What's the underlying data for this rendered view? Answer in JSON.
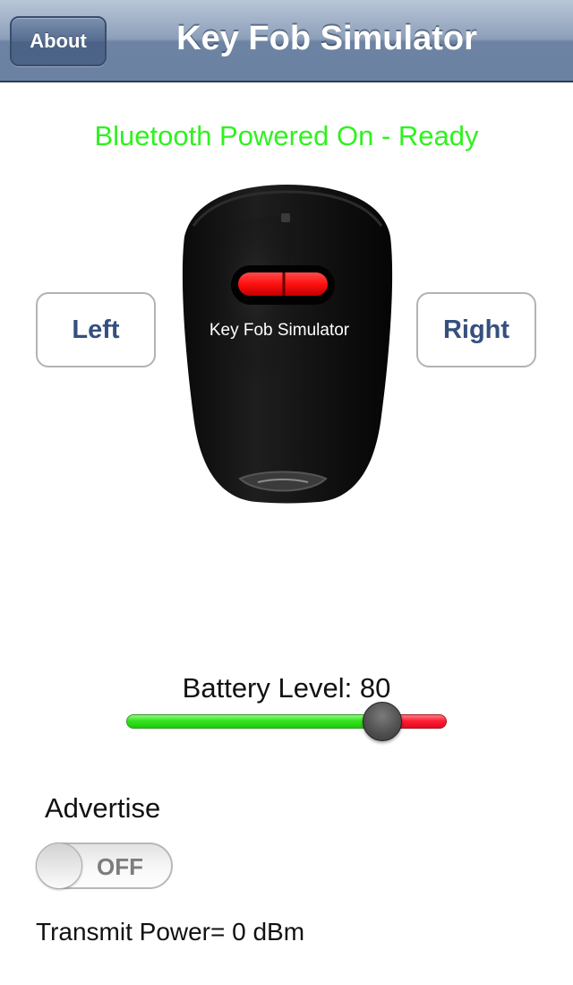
{
  "navbar": {
    "title": "Key Fob Simulator",
    "about_label": "About"
  },
  "status": {
    "text": "Bluetooth Powered On - Ready",
    "color": "#2ef21e"
  },
  "fob": {
    "label": "Key Fob Simulator",
    "icon": "key-fob-image"
  },
  "buttons": {
    "left_label": "Left",
    "right_label": "Right"
  },
  "battery": {
    "label": "Battery Level: 80",
    "level": 0.8,
    "fill_color": "#34e31e",
    "remaining_color": "#ff1d34"
  },
  "advertise": {
    "label": "Advertise",
    "toggle_state": "OFF"
  },
  "transmit": {
    "text": "Transmit Power= 0 dBm"
  }
}
